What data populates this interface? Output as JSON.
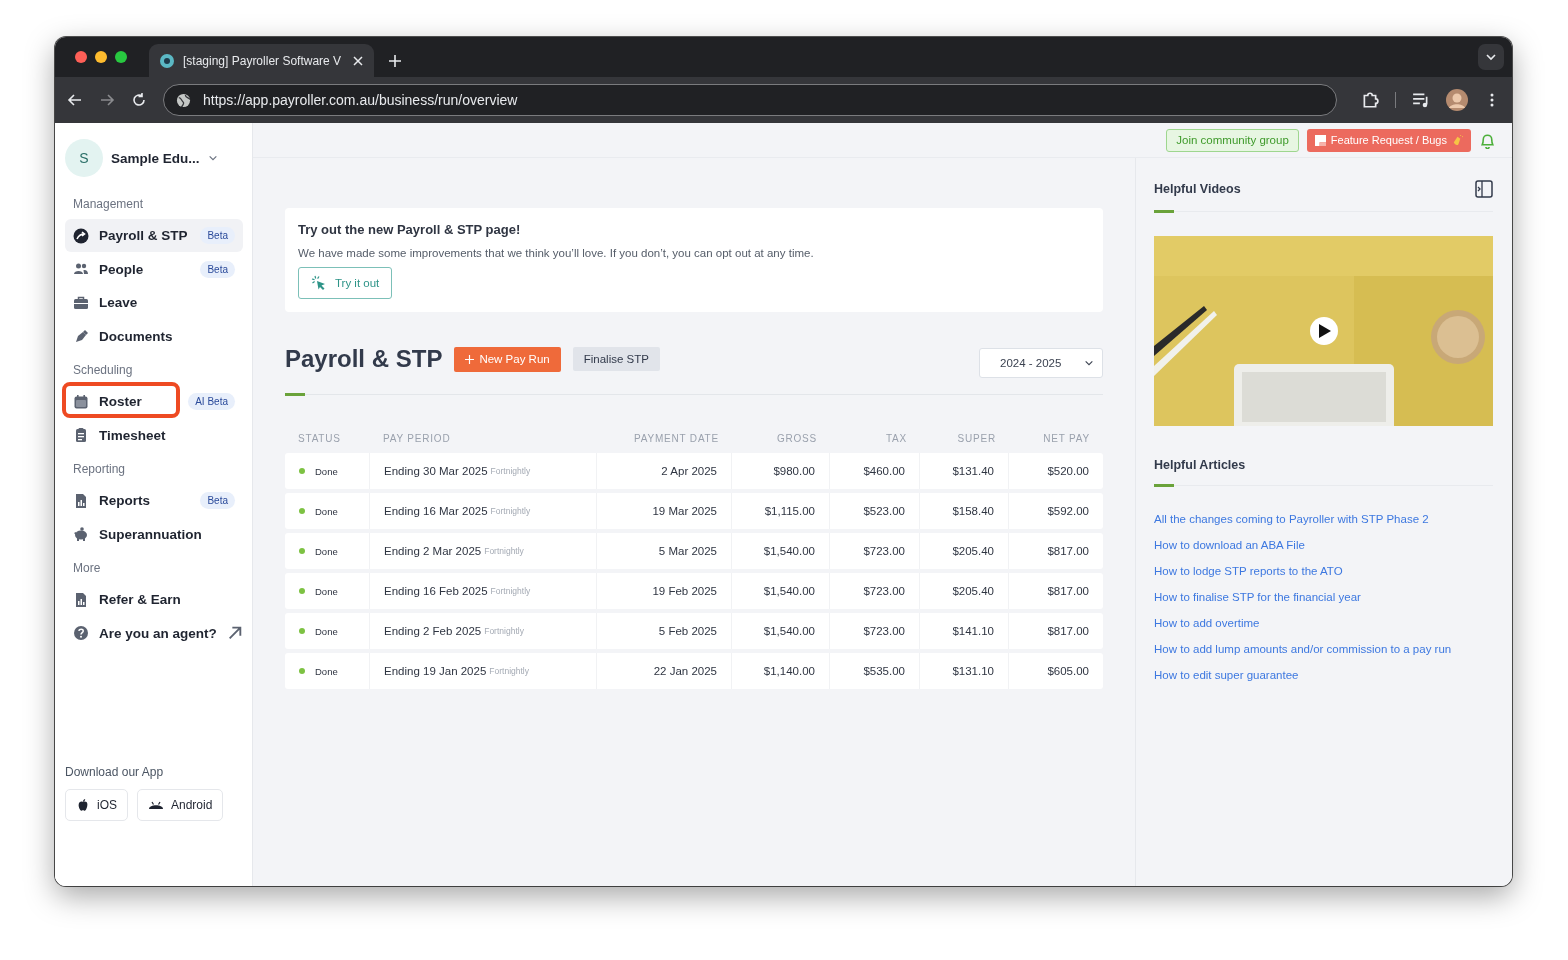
{
  "browser": {
    "tab_title": "[staging] Payroller Software V",
    "address": "https://app.payroller.com.au/business/run/overview"
  },
  "header": {
    "community": "Join community group",
    "feature": "Feature Request / Bugs"
  },
  "sidebar": {
    "business": {
      "initial": "S",
      "name": "Sample Edu..."
    },
    "sections": [
      {
        "title": "Management",
        "items": [
          {
            "label": "Payroll & STP",
            "badge": "Beta",
            "kind": "link",
            "selected": true,
            "highlighted": false
          },
          {
            "label": "People",
            "badge": "Beta",
            "kind": "link",
            "selected": false,
            "highlighted": false
          },
          {
            "label": "Leave",
            "kind": "link",
            "selected": false,
            "highlighted": false
          },
          {
            "label": "Documents",
            "kind": "link",
            "selected": false,
            "highlighted": false
          }
        ]
      },
      {
        "title": "Scheduling",
        "items": [
          {
            "label": "Roster",
            "badge": "AI Beta",
            "kind": "link",
            "selected": false,
            "highlighted": true
          },
          {
            "label": "Timesheet",
            "kind": "link",
            "selected": false,
            "highlighted": false
          }
        ]
      },
      {
        "title": "Reporting",
        "items": [
          {
            "label": "Reports",
            "badge": "Beta",
            "kind": "link",
            "selected": false,
            "highlighted": false
          },
          {
            "label": "Superannuation",
            "kind": "link",
            "selected": false,
            "highlighted": false
          }
        ]
      },
      {
        "title": "More",
        "items": [
          {
            "label": "Refer & Earn",
            "kind": "link",
            "selected": false,
            "highlighted": false
          },
          {
            "label": "Are you an agent?",
            "kind": "external",
            "selected": false,
            "highlighted": false
          }
        ]
      }
    ],
    "download": {
      "title": "Download our App",
      "apps": [
        "iOS",
        "Android"
      ]
    }
  },
  "banner": {
    "title": "Try out the new Payroll & STP page!",
    "text": "We have made some improvements that we think you’ll love. If you don’t, you can opt out at any time.",
    "button": "Try it out"
  },
  "payroll": {
    "title": "Payroll & STP",
    "new_button": "New Pay Run",
    "finalise_button": "Finalise STP",
    "year": "2024 - 2025"
  },
  "table": {
    "columns": [
      "STATUS",
      "PAY PERIOD",
      "PAYMENT DATE",
      "GROSS",
      "TAX",
      "SUPER",
      "NET PAY"
    ],
    "rows": [
      {
        "status": "Done",
        "period": "Ending 30 Mar 2025",
        "frequency": "Fortnightly",
        "payment_date": "2 Apr 2025",
        "gross": "$980.00",
        "tax": "$460.00",
        "super": "$131.40",
        "net_pay": "$520.00"
      },
      {
        "status": "Done",
        "period": "Ending 16 Mar 2025",
        "frequency": "Fortnightly",
        "payment_date": "19 Mar 2025",
        "gross": "$1,115.00",
        "tax": "$523.00",
        "super": "$158.40",
        "net_pay": "$592.00"
      },
      {
        "status": "Done",
        "period": "Ending 2 Mar 2025",
        "frequency": "Fortnightly",
        "payment_date": "5 Mar 2025",
        "gross": "$1,540.00",
        "tax": "$723.00",
        "super": "$205.40",
        "net_pay": "$817.00"
      },
      {
        "status": "Done",
        "period": "Ending 16 Feb 2025",
        "frequency": "Fortnightly",
        "payment_date": "19 Feb 2025",
        "gross": "$1,540.00",
        "tax": "$723.00",
        "super": "$205.40",
        "net_pay": "$817.00"
      },
      {
        "status": "Done",
        "period": "Ending 2 Feb 2025",
        "frequency": "Fortnightly",
        "payment_date": "5 Feb 2025",
        "gross": "$1,540.00",
        "tax": "$723.00",
        "super": "$141.10",
        "net_pay": "$817.00"
      },
      {
        "status": "Done",
        "period": "Ending 19 Jan 2025",
        "frequency": "Fortnightly",
        "payment_date": "22 Jan 2025",
        "gross": "$1,140.00",
        "tax": "$535.00",
        "super": "$131.10",
        "net_pay": "$605.00"
      }
    ]
  },
  "help": {
    "videos_title": "Helpful Videos",
    "articles_title": "Helpful Articles",
    "articles": [
      "All the changes coming to Payroller with STP Phase 2",
      "How to download an ABA File",
      "How to lodge STP reports to the ATO",
      "How to finalise STP for the financial year",
      "How to add overtime",
      "How to add lump amounts and/or commission to a pay run",
      "How to edit super guarantee"
    ]
  }
}
